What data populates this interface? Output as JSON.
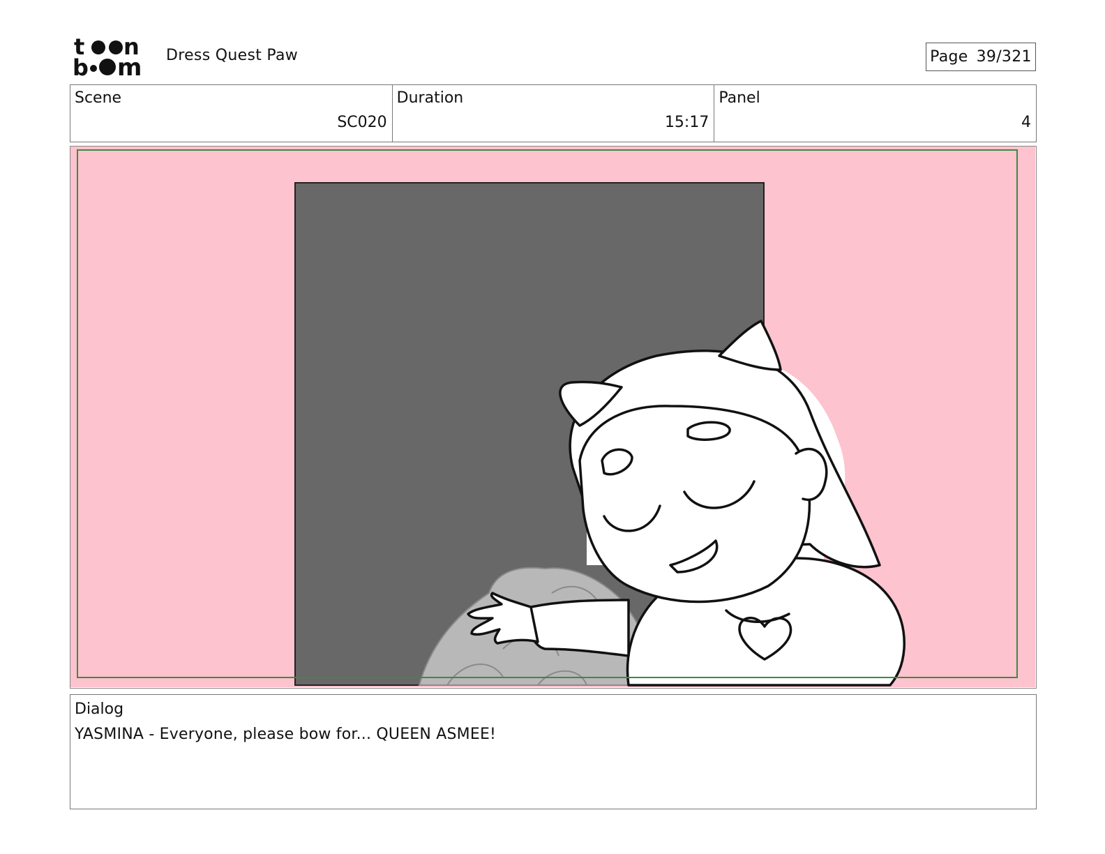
{
  "header": {
    "logo_text": "toonboom",
    "project_title": "Dress Quest Paw",
    "page_label": "Page",
    "page_number": "39/321"
  },
  "info": {
    "scene_label": "Scene",
    "scene_value": "SC020",
    "duration_label": "Duration",
    "duration_value": "15:17",
    "panel_label": "Panel",
    "panel_value": "4"
  },
  "panel_image": {
    "background_color": "#fdc3cf",
    "doorway_color": "#686868",
    "safe_frame_color": "#3f8a3f"
  },
  "dialog": {
    "label": "Dialog",
    "text": "YASMINA - Everyone, please bow for... QUEEN ASMEE!"
  }
}
